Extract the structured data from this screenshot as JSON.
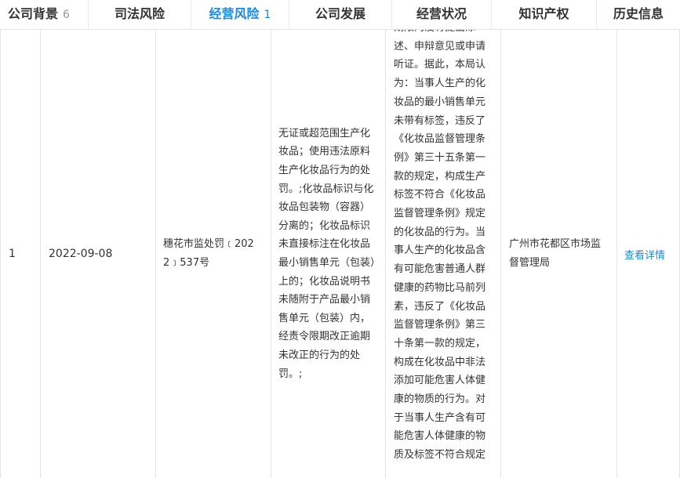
{
  "tabs": [
    {
      "label": "公司背景",
      "count": "6",
      "active": false
    },
    {
      "label": "司法风险",
      "count": "",
      "active": false
    },
    {
      "label": "经营风险",
      "count": "1",
      "active": true
    },
    {
      "label": "公司发展",
      "count": "",
      "active": false
    },
    {
      "label": "经营状况",
      "count": "",
      "active": false
    },
    {
      "label": "知识产权",
      "count": "",
      "active": false
    },
    {
      "label": "历史信息",
      "count": "",
      "active": false
    }
  ],
  "row": {
    "index": "1",
    "date": "2022-09-08",
    "document_no": "穗花市监处罚﹝2022﹞537号",
    "reason": "无证或超范围生产化妆品；使用违法原料生产化妆品行为的处罚。;化妆品标识与化妆品包装物（容器）分离的；化妆品标识未直接标注在化妆品最小销售单元（包装）上的；化妆品说明书未随附于产品最小销售单元（包装）内，经责令限期改正逾期未改正的行为的处罚。;",
    "result": "期限内没有提出陈述、申辩意见或申请听证。据此，本局认为：当事人生产的化妆品的最小销售单元未带有标签，违反了《化妆品监督管理条例》第三十五条第一款的规定，构成生产标签不符合《化妆品监督管理条例》规定的化妆品的行为。当事人生产的化妆品含有可能危害普通人群健康的药物比马前列素，违反了《化妆品监督管理条例》第三十条第一款的规定，构成在化妆品中非法添加可能危害人体健康的物质的行为。对于当事人生产含有可能危害人体健康的物质及标签不符合规定",
    "authority": "广州市花都区市场监督管理局",
    "action_label": "查看详情"
  }
}
